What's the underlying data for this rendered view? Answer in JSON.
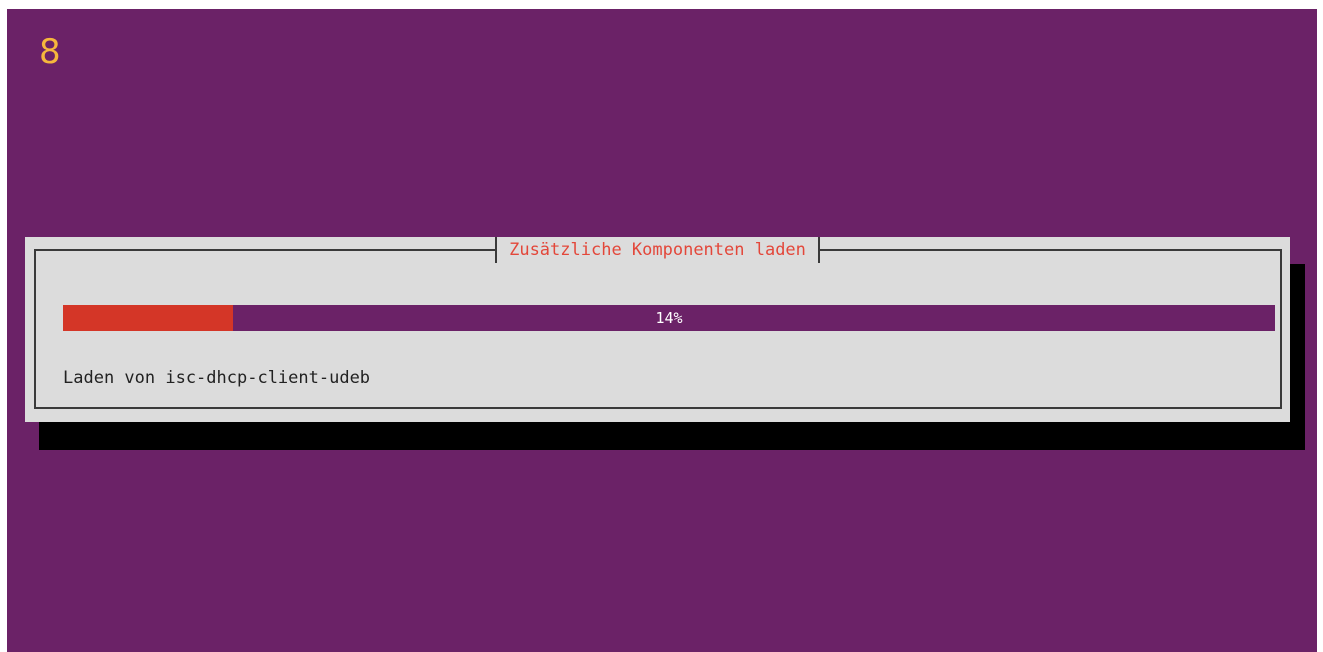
{
  "installer": {
    "step_number": "8",
    "dialog_title": "Zusätzliche Komponenten laden",
    "progress_percent_label": "14%",
    "progress_fraction": 0.14,
    "status_message": "Laden von isc-dhcp-client-udeb"
  },
  "colors": {
    "background": "#6b2267",
    "dialog": "#dcdcdc",
    "title": "#e3473a",
    "progress_fill": "#d43627",
    "step_number": "#f6b73c"
  }
}
